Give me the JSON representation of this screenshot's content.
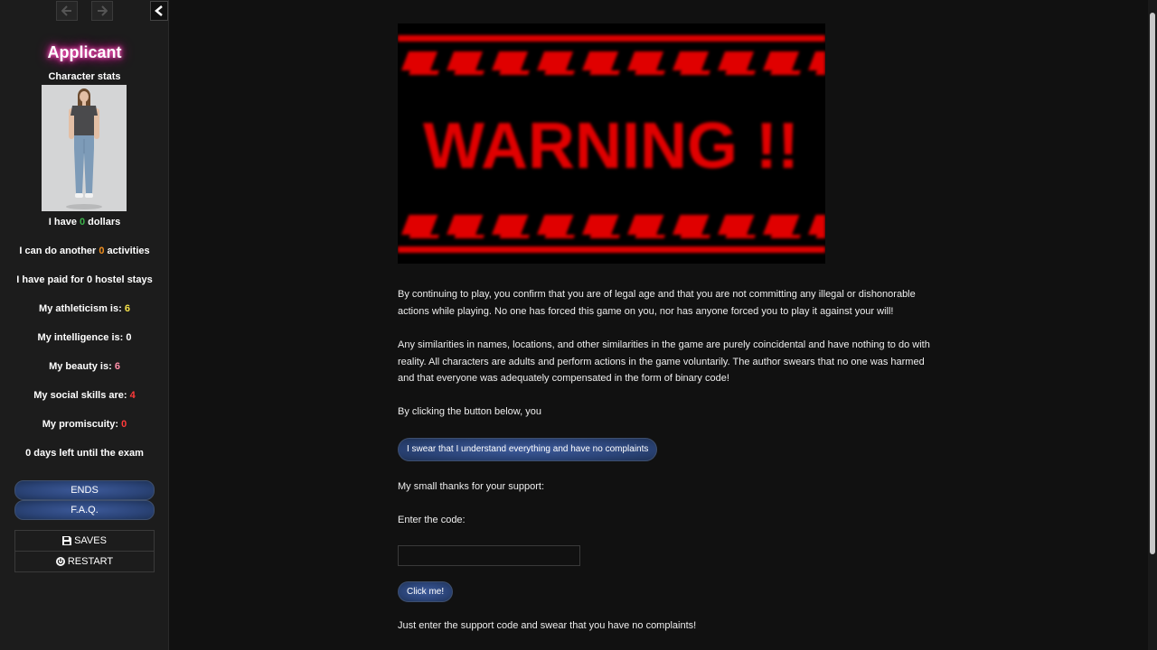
{
  "sidebar": {
    "title": "Applicant",
    "subtitle": "Character stats",
    "stats": [
      {
        "pre": "I have ",
        "val": "0",
        "post": " dollars"
      },
      {
        "pre": "I can do another ",
        "val": "0",
        "post": " activities"
      },
      {
        "pre": "I have paid for ",
        "val": "0",
        "post": " hostel stays"
      },
      {
        "pre": "My athleticism is: ",
        "val": "6",
        "post": ""
      },
      {
        "pre": "My intelligence is: ",
        "val": "0",
        "post": ""
      },
      {
        "pre": "My beauty is: ",
        "val": "6",
        "post": ""
      },
      {
        "pre": "My social skills are: ",
        "val": "4",
        "post": ""
      },
      {
        "pre": "My promiscuity: ",
        "val": "0",
        "post": ""
      },
      {
        "pre": "",
        "val": "0",
        "post": " days left until the exam"
      }
    ],
    "buttons": {
      "ends": "ENDS",
      "faq": "F.A.Q."
    },
    "menu": {
      "saves": "SAVES",
      "restart": "RESTART"
    }
  },
  "main": {
    "warning_image_text": "WARNING !!",
    "para1": "By continuing to play, you confirm that you are of legal age and that you are not committing any illegal or dishonorable actions while playing. No one has forced this game on you, nor has anyone forced you to play it against your will!",
    "para2": "Any similarities in names, locations, and other similarities in the game are purely coincidental and have nothing to do with reality. All characters are adults and perform actions in the game voluntarily. The author swears that no one was harmed and that everyone was adequately compensated in the form of binary code!",
    "para3": "By clicking the button below, you",
    "swear_button": "I swear that I understand everything and have no complaints",
    "thanks": "My small thanks for your support:",
    "enter_code": "Enter the code:",
    "code_value": "",
    "click_button": "Click me!",
    "footer": "Just enter the support code and swear that you have no complaints!"
  },
  "colors": {
    "sidebar_bg": "#1c1c1c",
    "main_bg": "#111111",
    "button_blue": "#2b4478",
    "title_glow": "#ff33b0",
    "warning_red": "#e00000"
  }
}
